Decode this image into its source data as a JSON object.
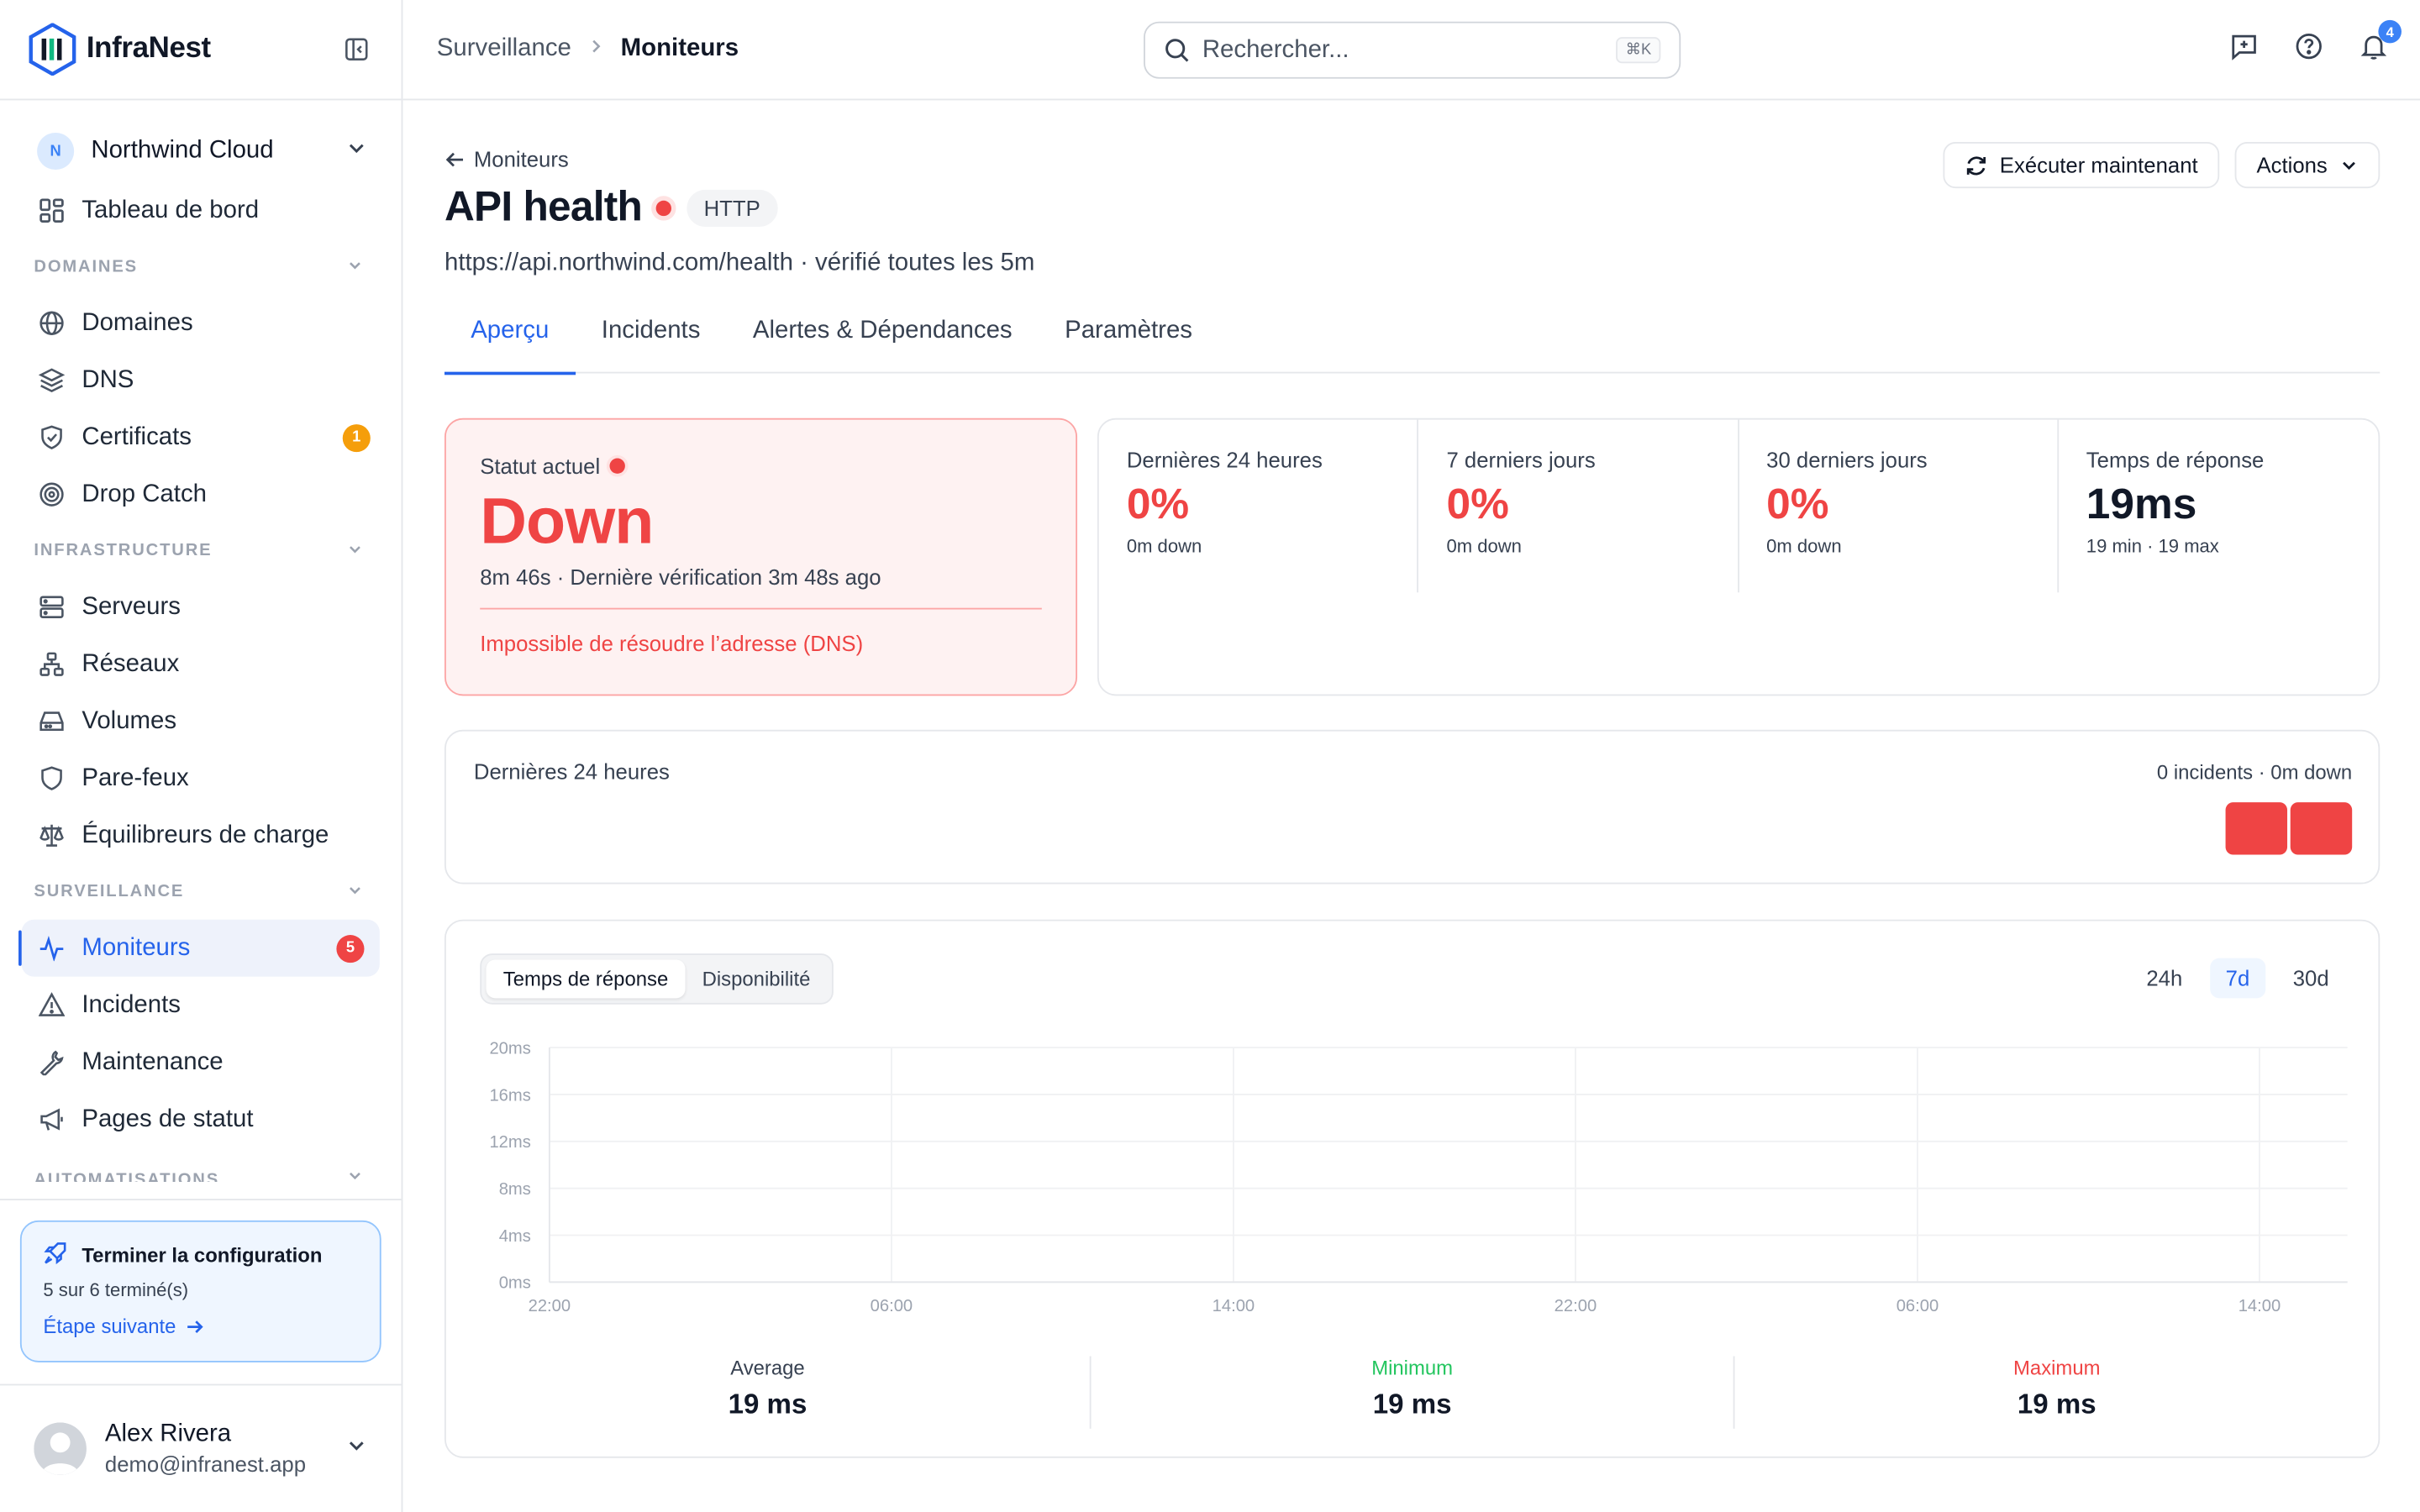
{
  "app": {
    "name": "InfraNest"
  },
  "org": {
    "initial": "N",
    "name": "Northwind Cloud"
  },
  "sidebar": {
    "dashboard": "Tableau de bord",
    "sections": {
      "domaines": "DOMAINES",
      "infrastructure": "INFRASTRUCTURE",
      "surveillance": "SURVEILLANCE",
      "automatisations": "AUTOMATISATIONS"
    },
    "items": {
      "domaines": "Domaines",
      "dns": "DNS",
      "certificats": "Certificats",
      "certificats_badge": "1",
      "drop_catch": "Drop Catch",
      "serveurs": "Serveurs",
      "reseaux": "Réseaux",
      "volumes": "Volumes",
      "pare_feux": "Pare-feux",
      "equilibreurs": "Équilibreurs de charge",
      "moniteurs": "Moniteurs",
      "moniteurs_badge": "5",
      "incidents": "Incidents",
      "maintenance": "Maintenance",
      "pages_statut": "Pages de statut"
    },
    "setup": {
      "title": "Terminer la configuration",
      "progress": "5 sur 6 terminé(s)",
      "next": "Étape suivante"
    },
    "user": {
      "name": "Alex Rivera",
      "email": "demo@infranest.app"
    }
  },
  "topbar": {
    "breadcrumb_parent": "Surveillance",
    "breadcrumb_current": "Moniteurs",
    "search_placeholder": "Rechercher...",
    "search_shortcut": "⌘K",
    "notifications_count": "4"
  },
  "monitor": {
    "back": "Moniteurs",
    "name": "API health",
    "type": "HTTP",
    "url_line": "https://api.northwind.com/health · vérifié toutes les 5m",
    "run_now": "Exécuter maintenant",
    "actions": "Actions",
    "tabs": [
      "Aperçu",
      "Incidents",
      "Alertes & Dépendances",
      "Paramètres"
    ],
    "status": {
      "label": "Statut actuel",
      "value": "Down",
      "meta": "8m 46s · Dernière vérification 3m 48s ago",
      "error": "Impossible de résoudre l’adresse (DNS)"
    },
    "stats": [
      {
        "label": "Dernières 24 heures",
        "value": "0%",
        "sub": "0m down"
      },
      {
        "label": "7 derniers jours",
        "value": "0%",
        "sub": "0m down"
      },
      {
        "label": "30 derniers jours",
        "value": "0%",
        "sub": "0m down"
      },
      {
        "label": "Temps de réponse",
        "value": "19ms",
        "sub": "19 min · 19 max"
      }
    ],
    "uptime": {
      "label": "Dernières 24 heures",
      "summary": "0 incidents · 0m down",
      "bars": [
        "down",
        "down"
      ]
    },
    "chart_controls": {
      "metric_tabs": [
        "Temps de réponse",
        "Disponibilité"
      ],
      "ranges": [
        "24h",
        "7d",
        "30d"
      ],
      "active_range": "7d"
    },
    "summary": [
      {
        "label": "Average",
        "value": "19 ms"
      },
      {
        "label": "Minimum",
        "value": "19 ms"
      },
      {
        "label": "Maximum",
        "value": "19 ms"
      }
    ]
  },
  "colors": {
    "accent": "#2563eb",
    "down": "#ef4444",
    "minimum": "#22c55e"
  },
  "chart_data": {
    "type": "line",
    "x": [
      "22:00",
      "06:00",
      "14:00",
      "22:00",
      "06:00",
      "14:00"
    ],
    "y_ticks": [
      "20ms",
      "16ms",
      "12ms",
      "8ms",
      "4ms",
      "0ms"
    ],
    "ylim": [
      0,
      20
    ],
    "grid": true,
    "series": []
  }
}
